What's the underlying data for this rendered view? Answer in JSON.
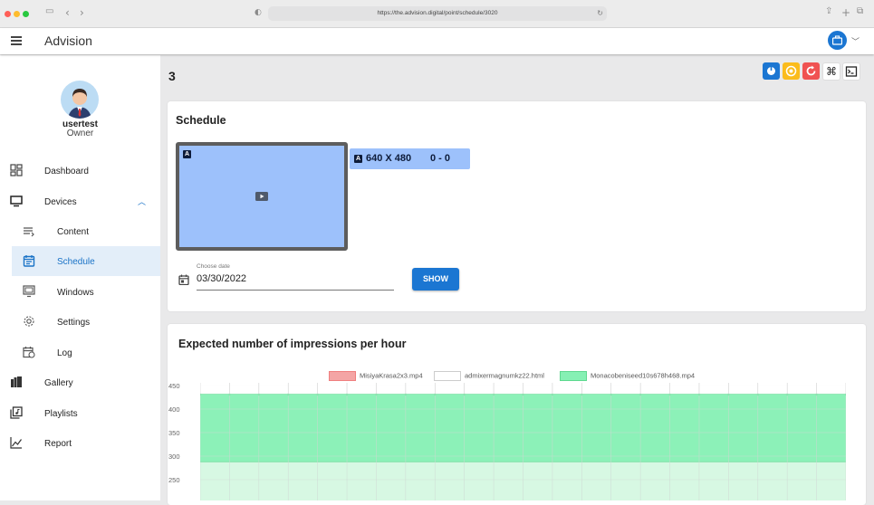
{
  "browser": {
    "url": "https://the.advision.digital/point/schedule/3020",
    "colors": {
      "close": "#ff5f57",
      "minimize": "#febc2e",
      "maximize": "#28c840"
    }
  },
  "app": {
    "title": "Advision",
    "accent": "#1b76d2"
  },
  "user": {
    "name": "usertest",
    "role": "Owner"
  },
  "sidebar": {
    "items": [
      {
        "label": "Dashboard",
        "icon": "dashboard-icon"
      },
      {
        "label": "Devices",
        "icon": "monitor-icon"
      },
      {
        "label": "Content",
        "icon": "content-list-icon"
      },
      {
        "label": "Schedule",
        "icon": "calendar-icon",
        "active": true
      },
      {
        "label": "Windows",
        "icon": "windows-icon"
      },
      {
        "label": "Settings",
        "icon": "gear-icon"
      },
      {
        "label": "Log",
        "icon": "log-calendar-icon"
      },
      {
        "label": "Gallery",
        "icon": "gallery-icon"
      },
      {
        "label": "Playlists",
        "icon": "playlist-icon"
      },
      {
        "label": "Report",
        "icon": "report-chart-icon"
      }
    ]
  },
  "page": {
    "title": "3",
    "toolbar": [
      {
        "icon": "power-icon",
        "color": "#1b76d2"
      },
      {
        "icon": "record-icon",
        "color": "#fbbc1c"
      },
      {
        "icon": "refresh-icon",
        "color": "#f05252"
      },
      {
        "icon": "command-icon",
        "color": "#ffffff"
      },
      {
        "icon": "terminal-icon",
        "color": "#ffffff"
      }
    ]
  },
  "schedule": {
    "title": "Schedule",
    "zone_badge": "A",
    "zone_resolution": "640 X 480",
    "zone_offset": "0 - 0",
    "date_label": "Choose date",
    "date_value": "03/30/2022",
    "show_label": "SHOW"
  },
  "impressions": {
    "title": "Expected number of impressions per hour"
  },
  "chart_data": {
    "type": "area",
    "title": "Expected number of impressions per hour",
    "series": [
      {
        "name": "MisiyaKrasa2x3.mp4",
        "color": "#f4a5a5",
        "values": []
      },
      {
        "name": "admixermagnumkz22.html",
        "color": "#ffffff",
        "values": []
      },
      {
        "name": "Monacobeniseed10s678h468.mp4",
        "color": "#86f0b4",
        "values": [
          432,
          432,
          432,
          432,
          432,
          432,
          432,
          432,
          432,
          432,
          432,
          432,
          432,
          432,
          432,
          432,
          432,
          432,
          432,
          432,
          432,
          432,
          432
        ]
      }
    ],
    "secondary_level": 288,
    "yticks": [
      450,
      400,
      350,
      300,
      250
    ],
    "ylim": [
      230,
      450
    ],
    "legend": "top",
    "grid": true
  }
}
